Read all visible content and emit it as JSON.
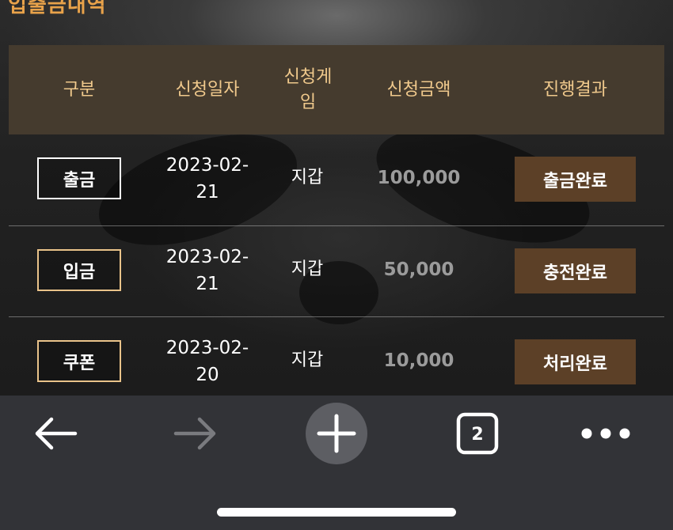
{
  "page": {
    "title": "입출금내역"
  },
  "table": {
    "headers": [
      "구분",
      "신청일자",
      "신청게임",
      "신청금액",
      "진행결과"
    ],
    "rows": [
      {
        "type": "출금",
        "date": "2023-02-21",
        "game": "지갑",
        "amount": "100,000",
        "result": "출금완료"
      },
      {
        "type": "입금",
        "date": "2023-02-21",
        "game": "지갑",
        "amount": "50,000",
        "result": "충전완료"
      },
      {
        "type": "쿠폰",
        "date": "2023-02-20",
        "game": "지갑",
        "amount": "10,000",
        "result": "처리완료"
      }
    ]
  },
  "toolbar": {
    "tab_count": "2",
    "icons": [
      "back-arrow-icon",
      "forward-arrow-icon",
      "new-tab-plus-icon",
      "tab-switcher-icon",
      "more-options-icon"
    ]
  },
  "colors": {
    "accent": "#e8a24a",
    "header_bg": "#453b2e",
    "header_text": "#f0c98c",
    "result_button_bg": "#5c4027",
    "amount_text": "#9b9b9b",
    "toolbar_bg": "#323337"
  }
}
